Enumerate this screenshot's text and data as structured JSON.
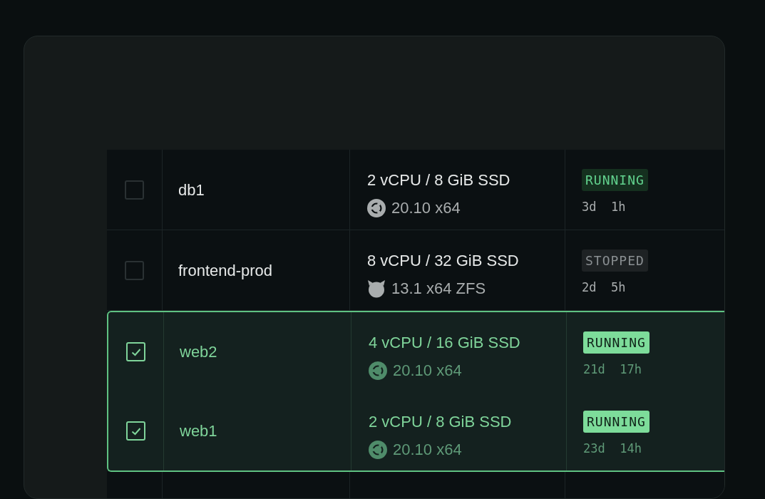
{
  "rows": [
    {
      "selected": false,
      "name": "db1",
      "spec": "2 vCPU / 8 GiB SSD",
      "os": {
        "kind": "ubuntu",
        "text": "20.10 x64"
      },
      "status": {
        "kind": "running",
        "text": "RUNNING"
      },
      "uptime": "3d  1h"
    },
    {
      "selected": false,
      "name": "frontend-prod",
      "spec": "8 vCPU / 32 GiB SSD",
      "os": {
        "kind": "freebsd",
        "text": "13.1 x64 ZFS"
      },
      "status": {
        "kind": "stopped",
        "text": "STOPPED"
      },
      "uptime": "2d  5h"
    },
    {
      "selected": true,
      "name": "web2",
      "spec": "4 vCPU / 16 GiB SSD",
      "os": {
        "kind": "ubuntu",
        "text": "20.10 x64"
      },
      "status": {
        "kind": "running",
        "text": "RUNNING"
      },
      "uptime": "21d  17h"
    },
    {
      "selected": true,
      "name": "web1",
      "spec": "2 vCPU / 8 GiB SSD",
      "os": {
        "kind": "ubuntu",
        "text": "20.10 x64"
      },
      "status": {
        "kind": "running",
        "text": "RUNNING"
      },
      "uptime": "23d  14h"
    }
  ]
}
